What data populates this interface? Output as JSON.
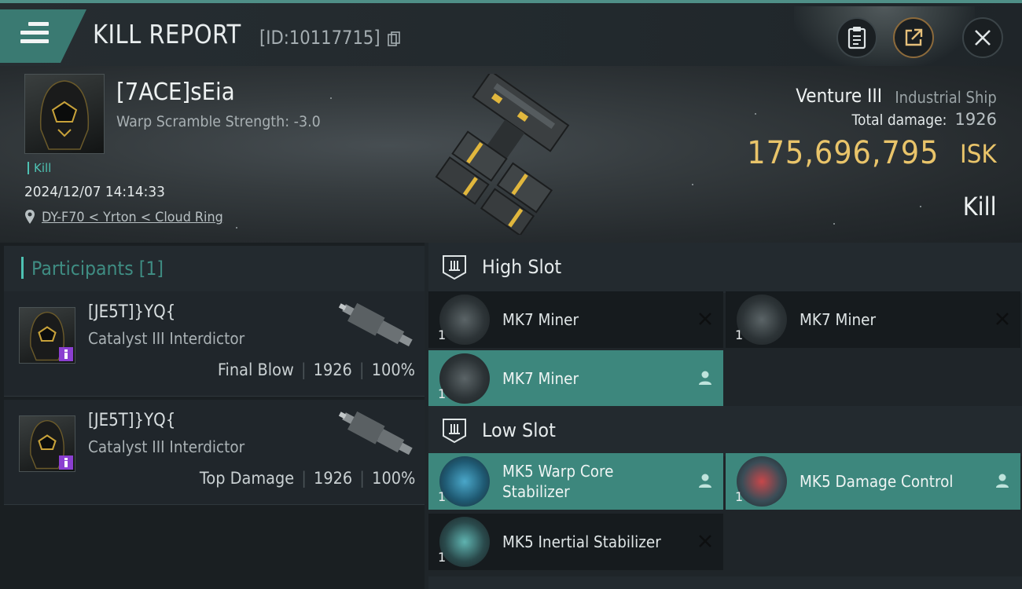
{
  "header": {
    "title": "KILL REPORT",
    "report_id": "[ID:10117715]"
  },
  "victim": {
    "name": "[7ACE]sEia",
    "warp_scramble": "Warp Scramble Strength: -3.0",
    "tag": "Kill",
    "datetime": "2024/12/07 14:14:33",
    "location": "DY-F70 < Yrton < Cloud Ring",
    "ship_name": "Venture III",
    "ship_class": "Industrial Ship",
    "total_damage_label": "Total damage:",
    "total_damage": "1926",
    "isk_value": "175,696,795",
    "isk_unit": "ISK",
    "result": "Kill"
  },
  "participants": {
    "title": "Participants [1]",
    "items": [
      {
        "name": "[JE5T]}YQ{",
        "ship": "Catalyst III Interdictor",
        "label": "Final Blow",
        "damage": "1926",
        "percent": "100%"
      },
      {
        "name": "[JE5T]}YQ{",
        "ship": "Catalyst III Interdictor",
        "label": "Top Damage",
        "damage": "1926",
        "percent": "100%"
      }
    ]
  },
  "fitting": {
    "high_slot": {
      "title": "High Slot",
      "modules": [
        {
          "name": "MK7 Miner",
          "qty": "1",
          "status": "destroyed"
        },
        {
          "name": "MK7 Miner",
          "qty": "1",
          "status": "destroyed"
        },
        {
          "name": "MK7 Miner",
          "qty": "1",
          "status": "dropped"
        }
      ]
    },
    "low_slot": {
      "title": "Low Slot",
      "modules": [
        {
          "name": "MK5 Warp Core Stabilizer",
          "name_line1": "MK5 Warp Core",
          "name_line2": "Stabilizer",
          "qty": "1",
          "status": "dropped"
        },
        {
          "name": "MK5 Damage Control",
          "qty": "1",
          "status": "dropped"
        },
        {
          "name": "MK5 Inertial Stabilizer",
          "qty": "1",
          "status": "destroyed"
        }
      ]
    }
  },
  "colors": {
    "accent": "#3d877d",
    "isk": "#e9c46a",
    "kill_tag": "#4ec2b3"
  },
  "icons": [
    "menu-icon",
    "copy-icon",
    "clipboard-icon",
    "share-icon",
    "close-icon",
    "location-pin-icon",
    "slot-icon",
    "person-icon",
    "destroyed-x-icon"
  ]
}
